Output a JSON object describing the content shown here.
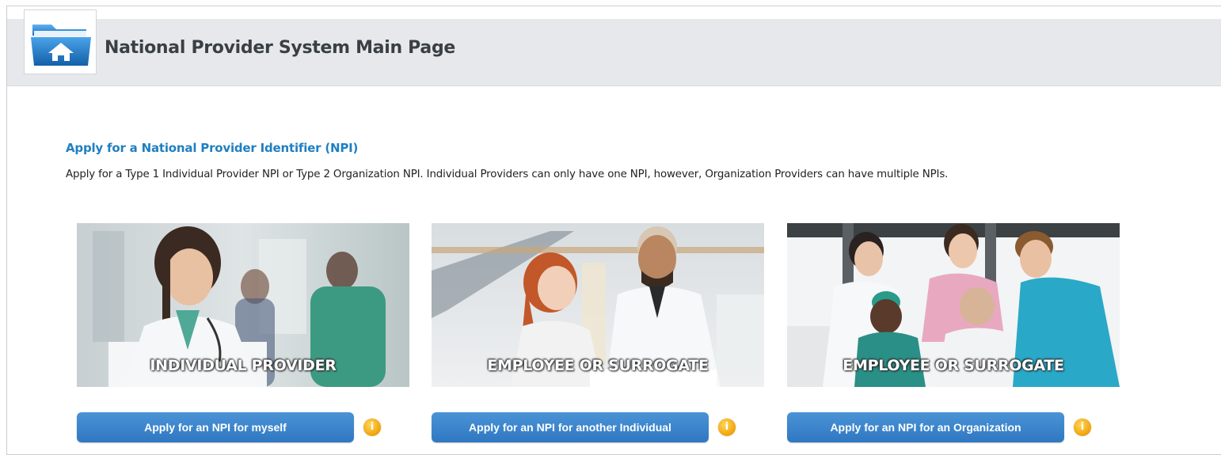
{
  "header": {
    "title": "National Provider System Main Page",
    "icon": "home-folder-icon"
  },
  "section": {
    "heading": "Apply for a National Provider Identifier (NPI)",
    "description": "Apply for a Type 1 Individual Provider NPI or Type 2 Organization NPI. Individual Providers can only have one NPI, however, Organization Providers can have multiple NPIs."
  },
  "cards": [
    {
      "caption": "INDIVIDUAL PROVIDER",
      "button_label": "Apply for an NPI for myself",
      "info_icon": "info-icon"
    },
    {
      "caption": "EMPLOYEE OR SURROGATE",
      "button_label": "Apply for an NPI for another Individual",
      "info_icon": "info-icon"
    },
    {
      "caption": "EMPLOYEE OR SURROGATE",
      "button_label": "Apply for an NPI for an Organization",
      "info_icon": "info-icon"
    }
  ],
  "colors": {
    "accent": "#1f7fc1",
    "button": "#3a86cc",
    "info": "#f0a20a",
    "header_bg": "#e6e8eb"
  }
}
